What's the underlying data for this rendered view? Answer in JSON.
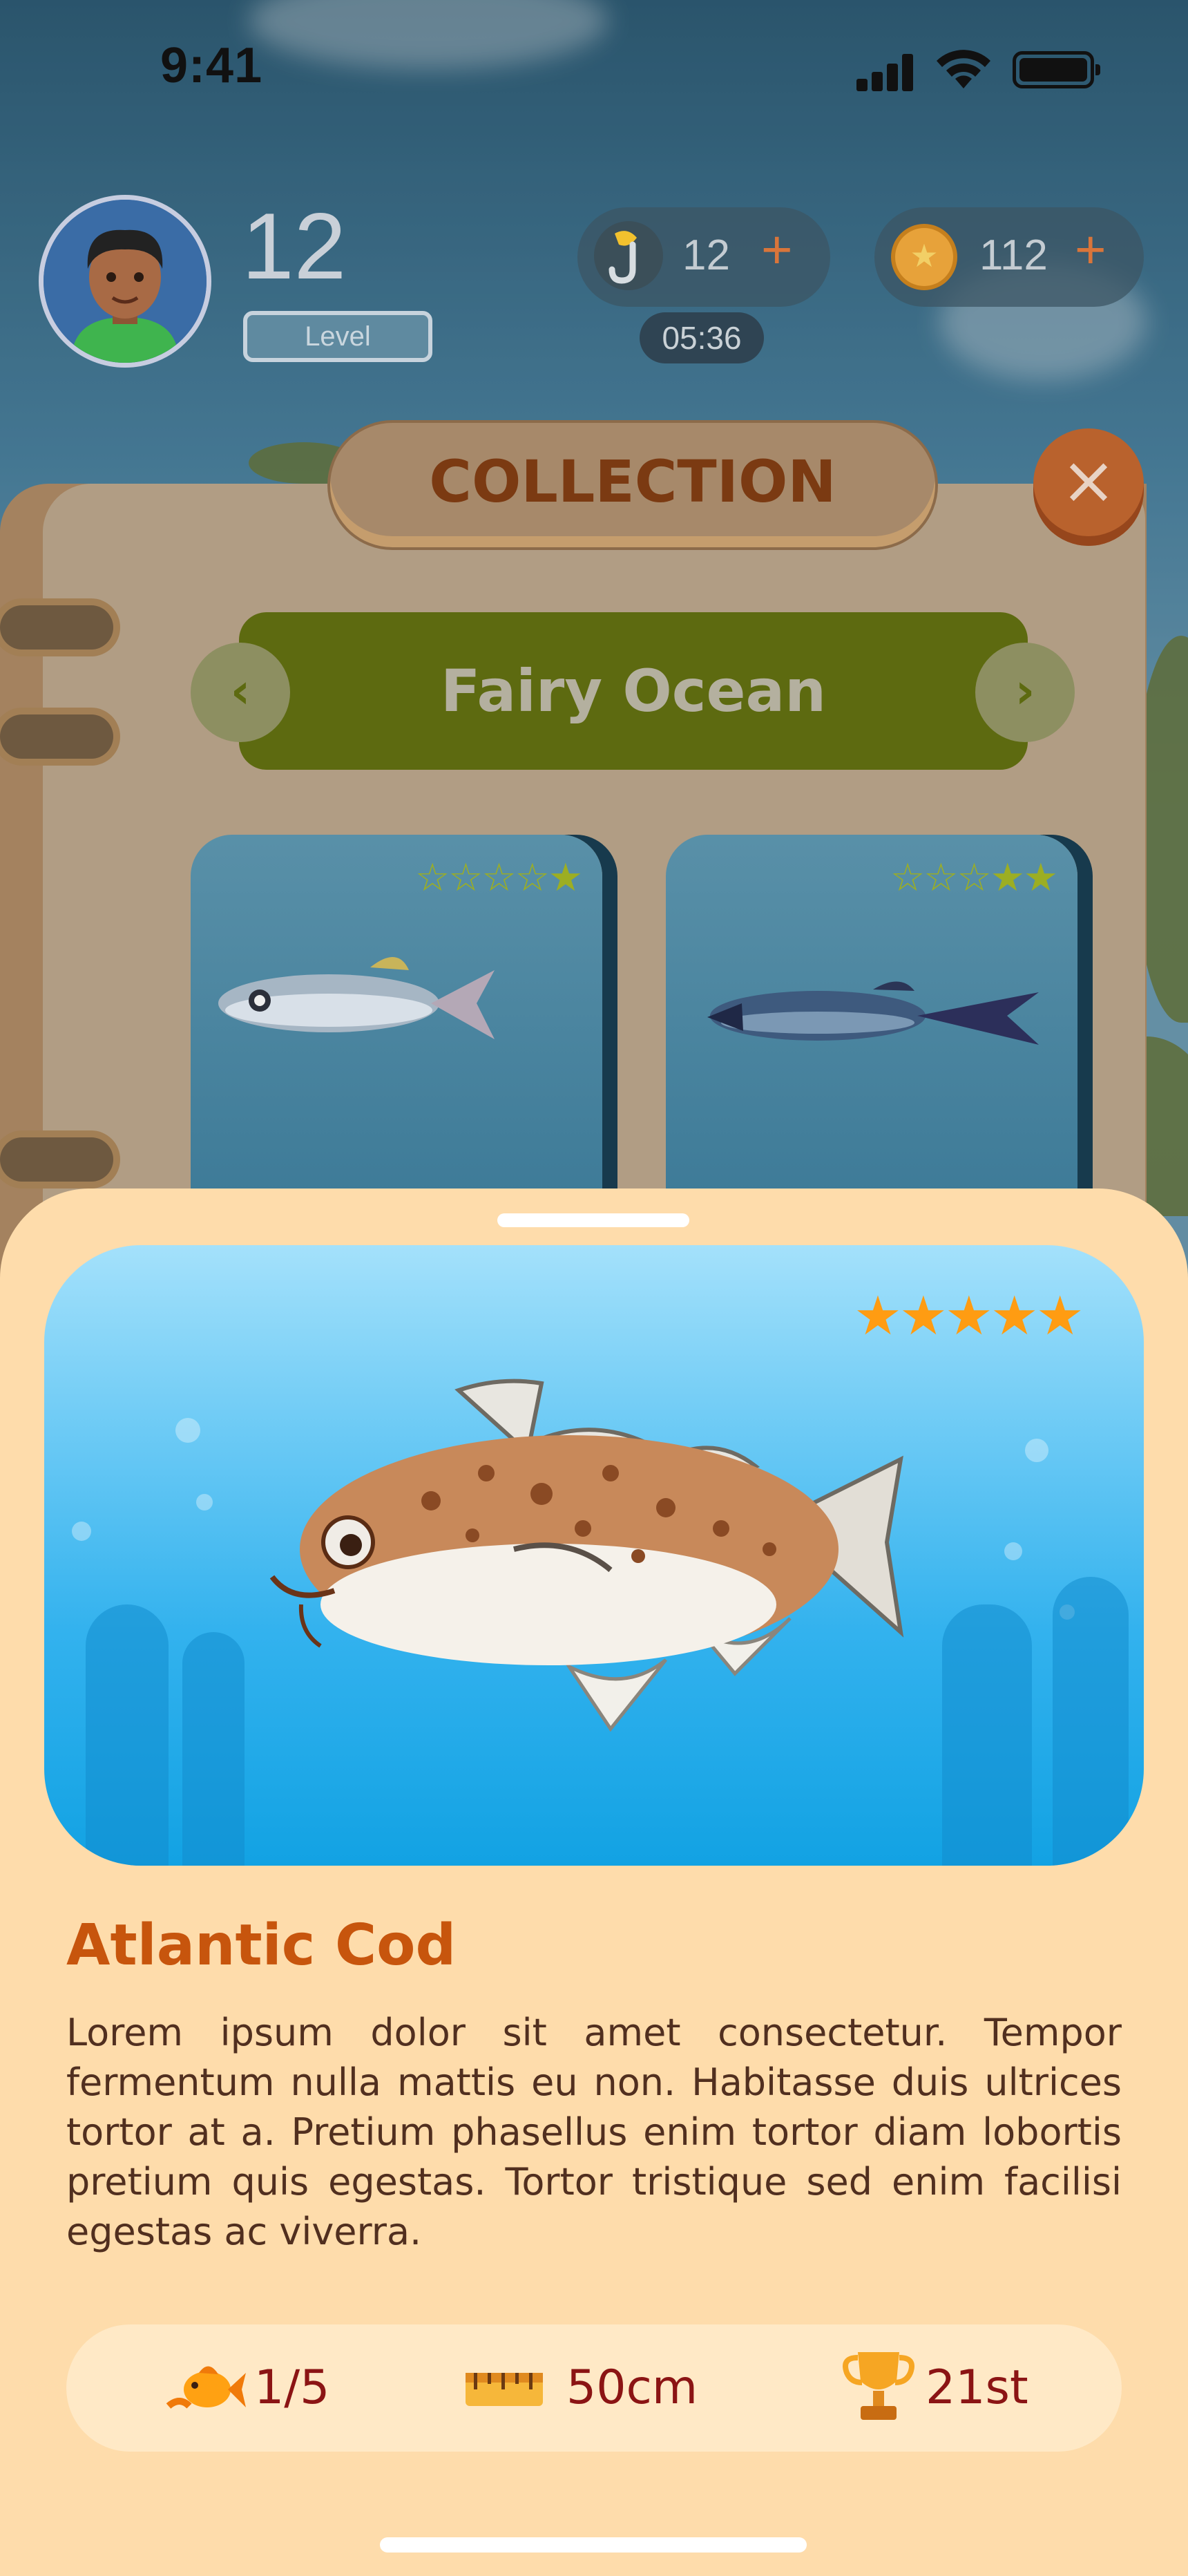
{
  "status_bar": {
    "time": "9:41"
  },
  "player": {
    "level": "12",
    "level_label": "Level"
  },
  "currencies": {
    "bait": {
      "value": "12",
      "plus": "+",
      "timer": "05:36"
    },
    "coins": {
      "value": "112",
      "plus": "+"
    }
  },
  "collection": {
    "title": "COLLECTION",
    "close": "×",
    "region": "Fairy Ocean",
    "prev": "‹",
    "next": "›",
    "cards": [
      {
        "stars_empty": "☆☆☆☆",
        "stars_filled": "★"
      },
      {
        "stars_empty": "☆☆☆",
        "stars_filled": "★★"
      }
    ]
  },
  "detail": {
    "stars": "★★★★★",
    "name": "Atlantic Cod",
    "description": "Lorem ipsum dolor sit amet consectetur. Tempor fermentum nulla mattis eu non. Habitasse duis ultrices tortor at a. Pretium phasellus enim tortor diam lobortis pretium quis egestas. Tortor tristique sed enim facilisi egestas ac viverra.",
    "stats": {
      "count": "1/5",
      "size": "50cm",
      "rank": "21st"
    }
  },
  "icons": {
    "bait": "hook-icon",
    "coin": "coin-icon",
    "count": "goldfish-icon",
    "size": "ruler-icon",
    "rank": "trophy-icon"
  },
  "colors": {
    "sheet": "#fedcab",
    "title_text": "#c7550d",
    "stat_text": "#8b1414",
    "region_bg": "#5d6a10",
    "close_bg": "#b9622d",
    "stars": "#ff9c12"
  }
}
